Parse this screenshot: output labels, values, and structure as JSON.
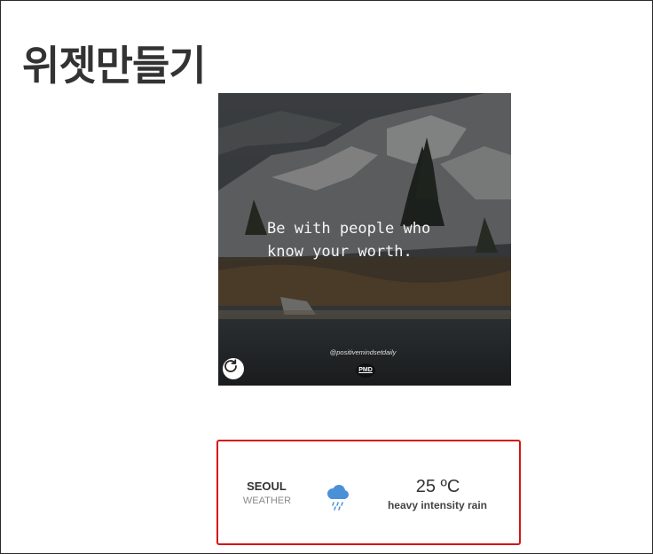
{
  "page": {
    "title": "위젯만들기"
  },
  "quote_card": {
    "text": "Be with people who\nknow your worth.",
    "handle": "@positivemindsetdaily",
    "logo": "PMD",
    "refresh_icon": "refresh-icon"
  },
  "weather": {
    "city": "SEOUL",
    "label": "WEATHER",
    "icon": "rain-cloud-icon",
    "temperature": "25 ºC",
    "description": "heavy intensity rain",
    "colors": {
      "border": "#d41414",
      "icon": "#4a90d9"
    }
  }
}
